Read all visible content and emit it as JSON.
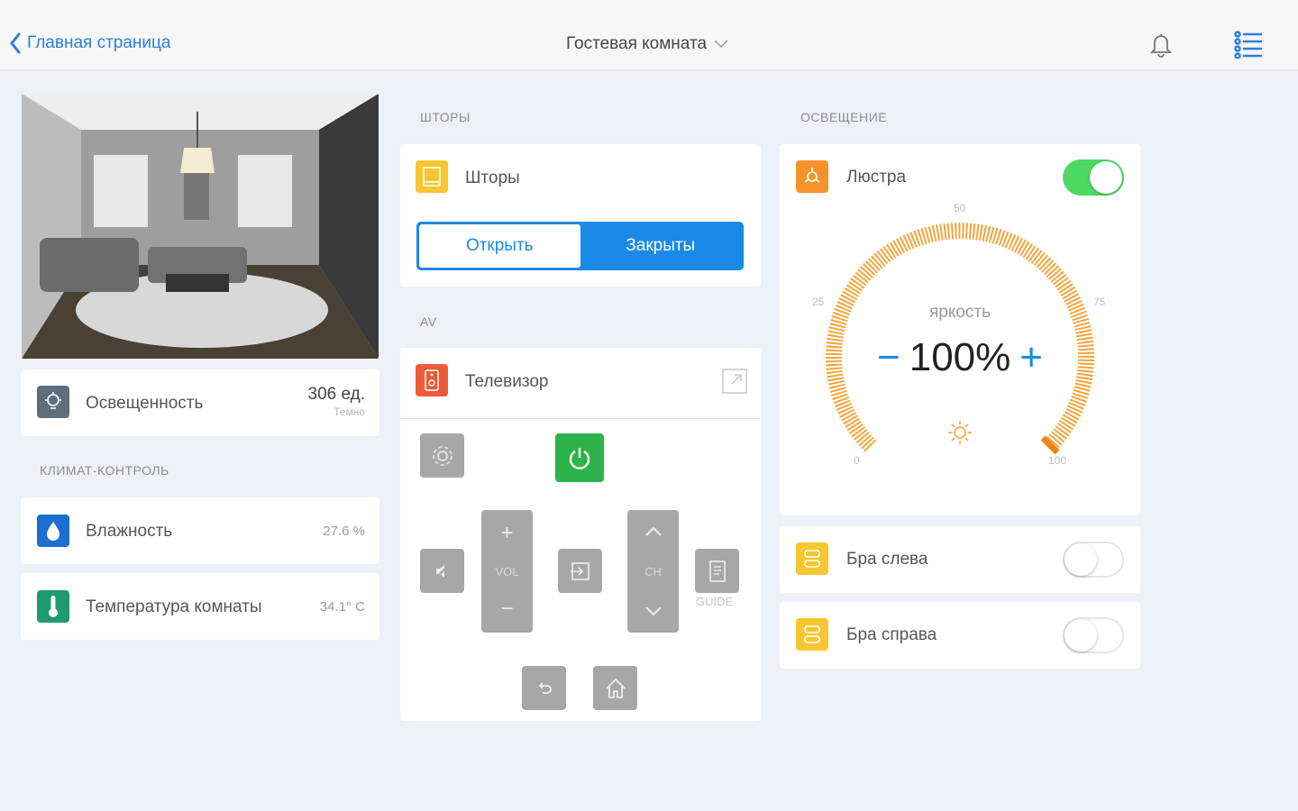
{
  "header": {
    "back_label": "Главная страница",
    "room_title": "Гостевая комната"
  },
  "left": {
    "illuminance": {
      "label": "Освещенность",
      "value": "306 ед.",
      "sub": "Темно"
    },
    "climate_section": "КЛИМАТ-КОНТРОЛЬ",
    "humidity": {
      "label": "Влажность",
      "value": "27.6 %"
    },
    "temperature": {
      "label": "Температура комнаты",
      "value": "34.1° C"
    }
  },
  "curtains": {
    "section": "ШТОРЫ",
    "title": "Шторы",
    "open_label": "Открыть",
    "closed_label": "Закрыты",
    "selected": "Открыть"
  },
  "av": {
    "section": "AV",
    "title": "Телевизор",
    "vol_label": "VOL",
    "ch_label": "CH",
    "guide_label": "GUIDE"
  },
  "lighting": {
    "section": "ОСВЕЩЕНИЕ",
    "chandelier": {
      "label": "Люстра",
      "on": true,
      "brightness_label": "яркость",
      "brightness_value": "100%",
      "brightness_percent": 100,
      "minus": "−",
      "plus": "+",
      "ticks": {
        "t0": "0",
        "t25": "25",
        "t50": "50",
        "t75": "75",
        "t100": "100"
      }
    },
    "sconce_left": {
      "label": "Бра слева",
      "on": false
    },
    "sconce_right": {
      "label": "Бра справа",
      "on": false
    }
  },
  "colors": {
    "accent": "#1a8ae6",
    "orange": "#f5a43a",
    "green": "#4cd964",
    "power_green": "#2cb34a"
  }
}
